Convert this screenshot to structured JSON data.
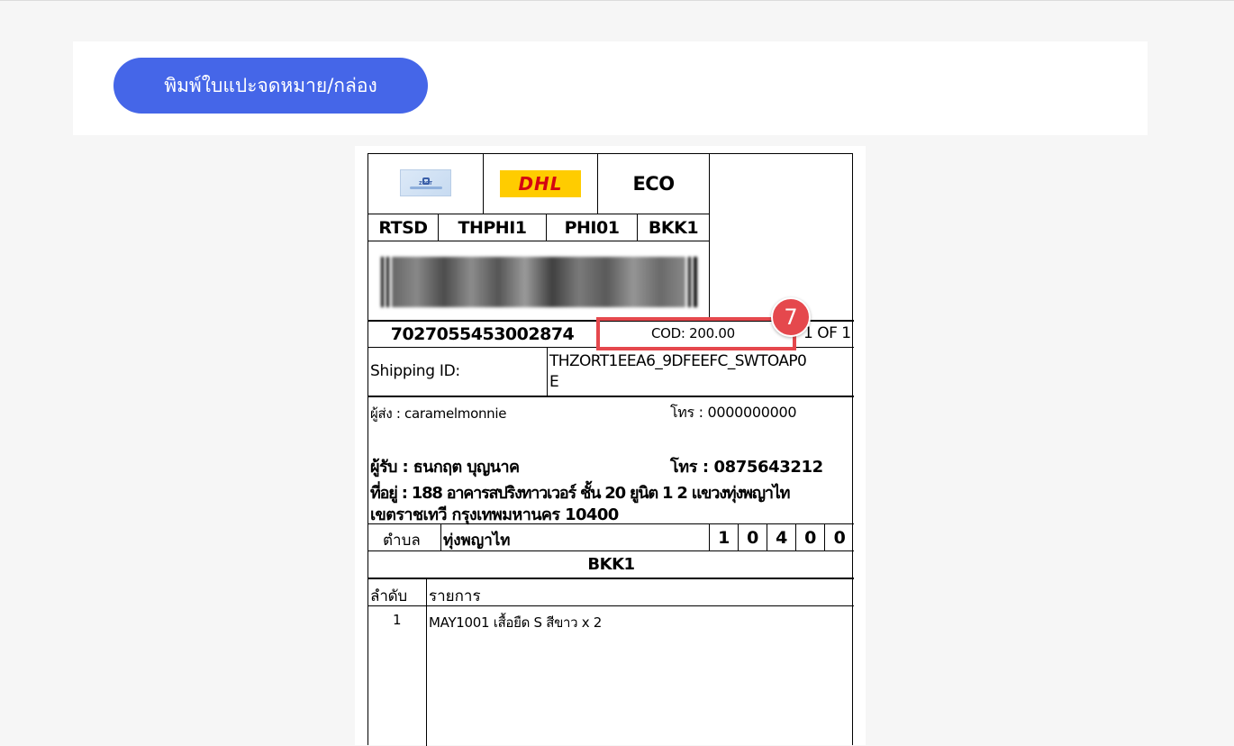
{
  "toolbar": {
    "print_button": "พิมพ์ใบแปะจดหมาย/กล่อง"
  },
  "label": {
    "service": "ECO",
    "logos": {
      "zort_text": "ZORT",
      "carrier": "DHL"
    },
    "routing": [
      "RTSD",
      "THPHI1",
      "PHI01",
      "BKK1"
    ],
    "tracking_number": "7027055453002874",
    "cod": "COD: 200.00",
    "piece": "1 OF 1",
    "badge": "7",
    "shipping_id_label": "Shipping ID:",
    "shipping_id_line1": "THZORT1EEA6_9DFEEFC_SWTOAP0",
    "shipping_id_line2": "E",
    "sender": "ผู้ส่ง : caramelmonnie",
    "sender_phone": "โทร : 0000000000",
    "receiver": "ผู้รับ : ธนกฤต บุญนาค",
    "receiver_phone": "โทร : 0875643212",
    "address_line1": "ที่อยู่ : 188 อาคารสปริงทาวเวอร์ ชั้น 20 ยูนิต 1 2 แขวงทุ่งพญาไท",
    "address_line2": "เขตราชเทวี กรุงเทพมหานคร 10400",
    "subdistrict_label": "ตำบล",
    "subdistrict_value": "ทุ่งพญาไท",
    "postal_digits": [
      "1",
      "0",
      "4",
      "0",
      "0"
    ],
    "sort_code": "BKK1",
    "items_header": {
      "no": "ลำดับ",
      "item": "รายการ"
    },
    "items": [
      {
        "no": "1",
        "desc": "MAY1001 เสื้อยืด S สีขาว x 2"
      }
    ]
  },
  "colors": {
    "accent": "#4566e8",
    "highlight": "#e5484d",
    "dhl_yellow": "#ffcc00",
    "dhl_red": "#d40511"
  }
}
